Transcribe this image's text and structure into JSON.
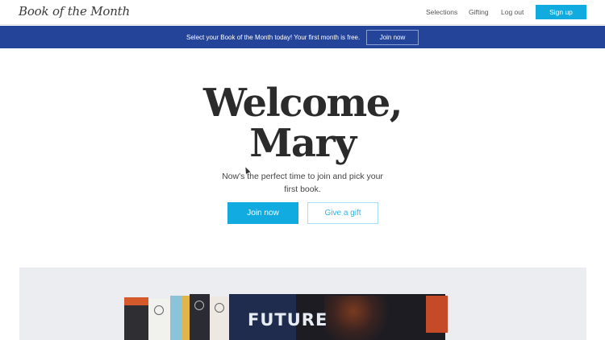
{
  "nav": {
    "logo": "Book of the Month",
    "links": [
      "Selections",
      "Gifting",
      "Log out"
    ],
    "signup_label": "Sign up"
  },
  "banner": {
    "text": "Select your Book of the Month today! Your first month is free.",
    "button_label": "Join now"
  },
  "hero": {
    "title_line1": "Welcome,",
    "title_line2": "Mary",
    "subtitle": "Now's the perfect time to join and pick your first book.",
    "join_label": "Join now",
    "gift_label": "Give a gift"
  },
  "books": {
    "cover_text": "FUTURE"
  },
  "colors": {
    "accent": "#12abe0",
    "banner": "#24449a"
  }
}
